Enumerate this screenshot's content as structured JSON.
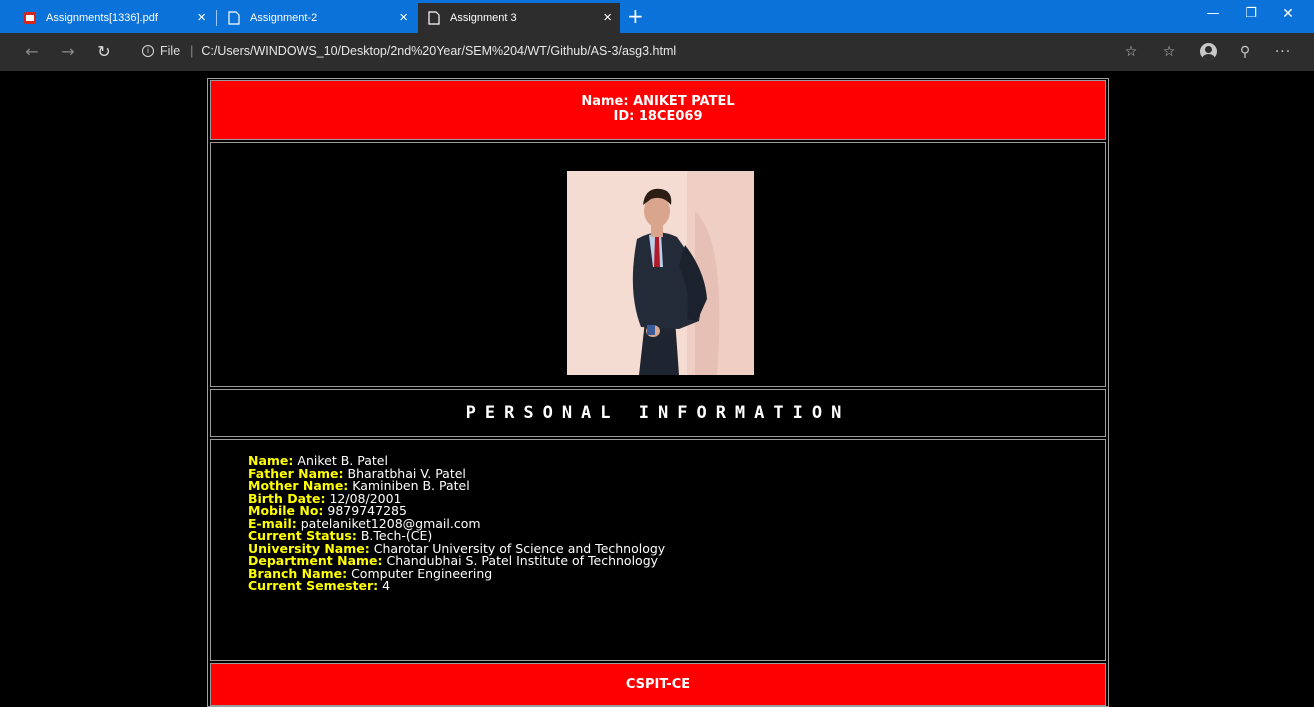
{
  "browser": {
    "tabs": [
      {
        "title": "Assignments[1336].pdf",
        "icon": "pdf-icon"
      },
      {
        "title": "Assignment-2",
        "icon": "page-icon"
      },
      {
        "title": "Assignment 3",
        "icon": "page-icon",
        "active": true
      }
    ],
    "file_label": "File",
    "url": "C:/Users/WINDOWS_10/Desktop/2nd%20Year/SEM%204/WT/Github/AS-3/asg3.html",
    "colors": {
      "tab_strip": "#0a72d8",
      "toolbar": "#2d2d2d"
    }
  },
  "page": {
    "header": {
      "name_line": "Name: ANIKET PATEL",
      "id_line": "ID: 18CE069"
    },
    "section_title": "PERSONAL INFORMATION",
    "info": [
      {
        "label": "Name:",
        "value": "Aniket B. Patel"
      },
      {
        "label": "Father Name:",
        "value": "Bharatbhai V. Patel"
      },
      {
        "label": "Mother Name:",
        "value": "Kaminiben B. Patel"
      },
      {
        "label": "Birth Date:",
        "value": "12/08/2001"
      },
      {
        "label": "Mobile No:",
        "value": "9879747285"
      },
      {
        "label": "E-mail:",
        "value": "patelaniket1208@gmail.com"
      },
      {
        "label": "Current Status:",
        "value": "B.Tech-(CE)"
      },
      {
        "label": "University Name:",
        "value": "Charotar University of Science and Technology"
      },
      {
        "label": "Department Name:",
        "value": "Chandubhai S. Patel Institute of Technology"
      },
      {
        "label": "Branch Name:",
        "value": "Computer Engineering"
      },
      {
        "label": "Current Semester:",
        "value": "4"
      }
    ],
    "footer": "CSPIT-CE",
    "colors": {
      "banner": "#ff0000",
      "label": "#ffff00",
      "background": "#000000"
    }
  }
}
